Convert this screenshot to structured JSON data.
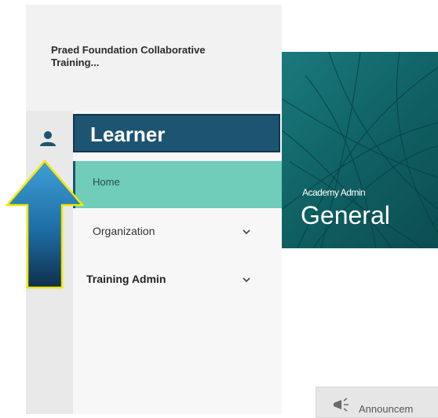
{
  "org": {
    "name": "Praed Foundation Collaborative Training..."
  },
  "sidebar": {
    "header_label": "Learner",
    "items": [
      {
        "label": "Home",
        "active": true
      },
      {
        "label": "Organization",
        "expandable": true
      },
      {
        "label": "Training Admin",
        "expandable": true
      }
    ]
  },
  "banner": {
    "subtitle": "Academy Admin",
    "title": "General"
  },
  "announcement": {
    "label": "Announcem"
  },
  "icons": {
    "profile": "person-icon",
    "chevron": "chevron-down-icon",
    "announcement": "megaphone-icon",
    "annotation": "up-arrow-icon"
  },
  "colors": {
    "nav_header": "#1d5472",
    "active_item": "#6fcdb9",
    "banner": "#0f5f62",
    "arrow_outline": "#f2e600"
  }
}
